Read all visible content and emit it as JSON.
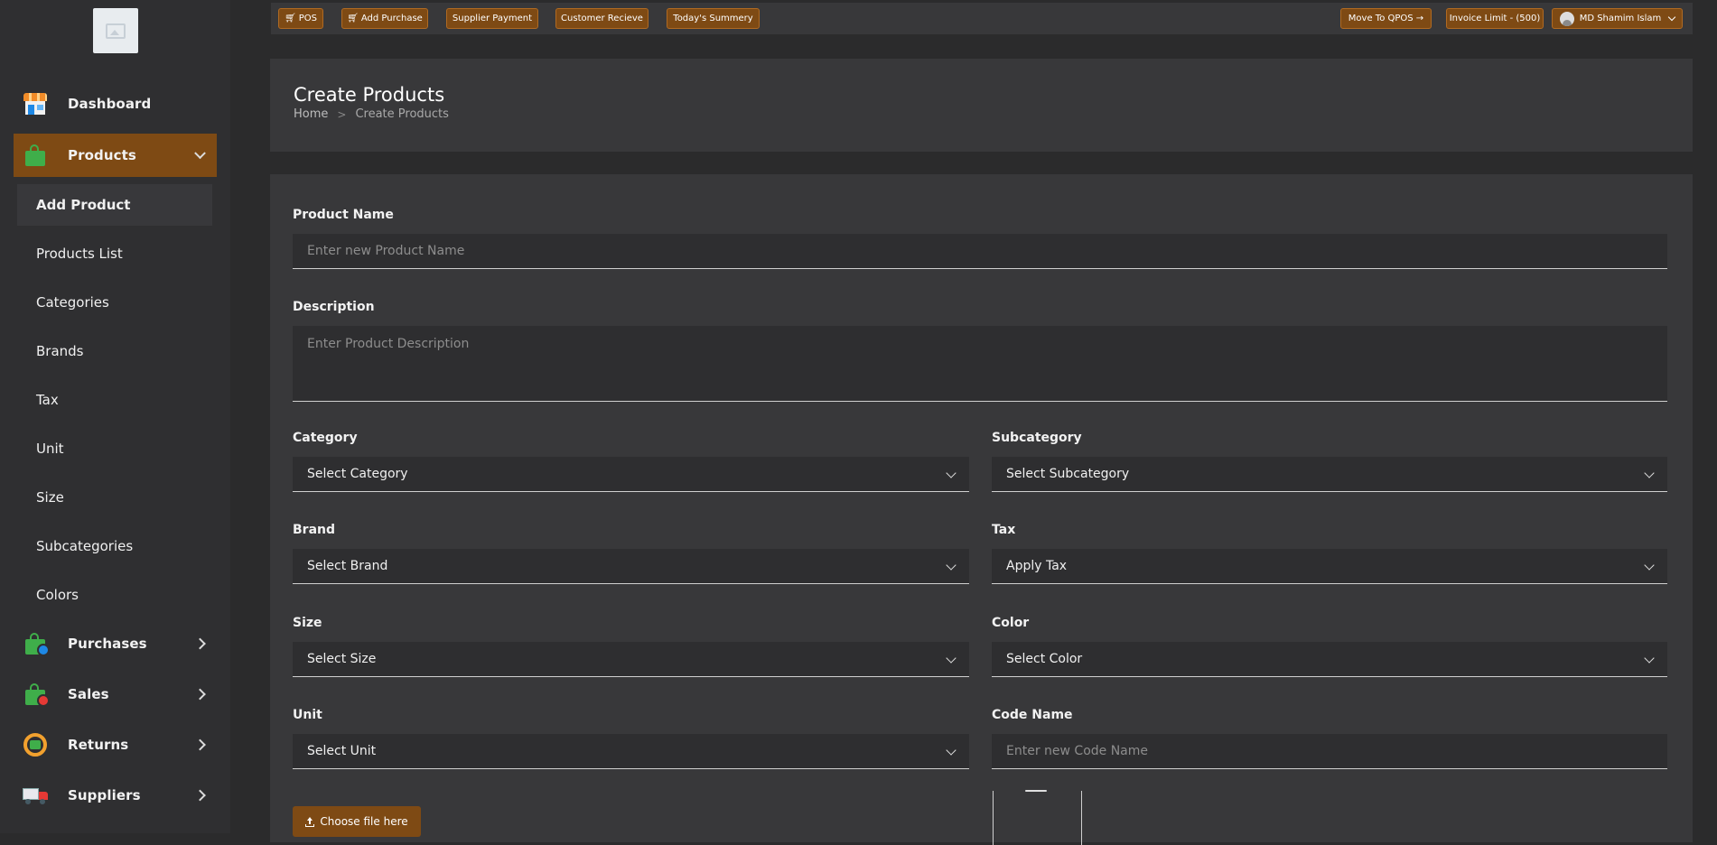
{
  "topbar": {
    "pos": "POS",
    "add_purchase": "Add Purchase",
    "supplier_payment": "Supplier Payment",
    "customer_receive": "Customer Recieve",
    "todays_summary": "Today's Summery",
    "move_to_qpos": "Move To QPOS →",
    "invoice_limit": "Invoice Limit - (500)",
    "user_name": "MD Shamim Islam"
  },
  "sidebar": {
    "items": [
      {
        "label": "Dashboard",
        "icon": "store-icon"
      },
      {
        "label": "Products",
        "icon": "shopping-bag-icon",
        "expanded": true
      },
      {
        "label": "Purchases",
        "icon": "shopping-bag-plus-icon"
      },
      {
        "label": "Sales",
        "icon": "shopping-bag-minus-icon"
      },
      {
        "label": "Returns",
        "icon": "return-icon"
      },
      {
        "label": "Suppliers",
        "icon": "truck-icon"
      }
    ],
    "sub_items": [
      "Add Product",
      "Products List",
      "Categories",
      "Brands",
      "Tax",
      "Unit",
      "Size",
      "Subcategories",
      "Colors"
    ],
    "active_sub": "Add Product"
  },
  "header": {
    "title": "Create Products",
    "breadcrumb_home": "Home",
    "breadcrumb_sep": ">",
    "breadcrumb_current": "Create Products"
  },
  "form": {
    "product_name": {
      "label": "Product Name",
      "placeholder": "Enter new Product Name",
      "value": ""
    },
    "description": {
      "label": "Description",
      "placeholder": "Enter Product Description",
      "value": ""
    },
    "category": {
      "label": "Category",
      "value": "Select Category"
    },
    "subcategory": {
      "label": "Subcategory",
      "value": "Select Subcategory"
    },
    "brand": {
      "label": "Brand",
      "value": "Select Brand"
    },
    "tax": {
      "label": "Tax",
      "value": "Apply Tax"
    },
    "size": {
      "label": "Size",
      "value": "Select Size"
    },
    "color": {
      "label": "Color",
      "value": "Select Color"
    },
    "unit": {
      "label": "Unit",
      "value": "Select Unit"
    },
    "code_name": {
      "label": "Code Name",
      "placeholder": "Enter new Code Name",
      "value": ""
    },
    "file_button": "Choose file here"
  },
  "colors": {
    "accent": "#7e4a14",
    "sidebar_bg": "#2f2f31",
    "card_bg": "#38383a",
    "page_bg": "#2b2b2c"
  }
}
